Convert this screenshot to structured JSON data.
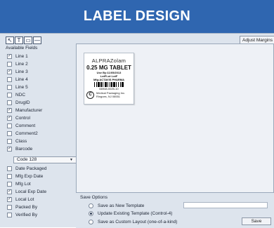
{
  "banner": {
    "title": "LABEL DESIGN"
  },
  "toolbar": {
    "tools": [
      {
        "name": "pointer-tool",
        "glyph": "↖"
      },
      {
        "name": "text-tool",
        "glyph": "T"
      },
      {
        "name": "rectangle-tool",
        "glyph": "▭"
      },
      {
        "name": "line-tool",
        "glyph": "—"
      }
    ],
    "adjust_label": "Adjust Margins"
  },
  "fields_panel": {
    "title": "Available Fields",
    "fields": [
      {
        "label": "Line 1",
        "checked": true
      },
      {
        "label": "Line 2",
        "checked": false
      },
      {
        "label": "Line 3",
        "checked": true
      },
      {
        "label": "Line 4",
        "checked": false
      },
      {
        "label": "Line 5",
        "checked": false
      },
      {
        "label": "NDC",
        "checked": false
      },
      {
        "label": "DrugID",
        "checked": false
      },
      {
        "label": "Manufacturer",
        "checked": true
      },
      {
        "label": "Control",
        "checked": true
      },
      {
        "label": "Comment",
        "checked": false
      },
      {
        "label": "Comment2",
        "checked": false
      },
      {
        "label": "Class",
        "checked": false
      },
      {
        "label": "Barcode",
        "checked": true
      },
      {
        "label": "Date Packaged",
        "checked": false
      },
      {
        "label": "Mfg Exp Date",
        "checked": false
      },
      {
        "label": "Mfg Lot",
        "checked": false
      },
      {
        "label": "Local Exp Date",
        "checked": true
      },
      {
        "label": "Local Lot",
        "checked": true
      },
      {
        "label": "Packed By",
        "checked": false
      },
      {
        "label": "Verified By",
        "checked": false
      }
    ],
    "barcode_type": "Code 128"
  },
  "label_preview": {
    "drug_name": "ALPRAZolam",
    "strength": "0.25 MG TABLET",
    "use_by": "Use By:11/05/2013",
    "lot": "LotFLot LotF",
    "mfg": "Mfg:ACTAVIS PHARMA",
    "barcode_text": "66948-0025-10",
    "logo_letter": "C",
    "packager_line1": "Medical Packaging Inc.",
    "packager_line2": "Ringoes, NJ 08551"
  },
  "save_options": {
    "title": "Save Options",
    "options": [
      {
        "label": "Save as New Template",
        "selected": false
      },
      {
        "label": "Update Existing Template (Control-4)",
        "selected": true
      },
      {
        "label": "Save as Custom Layout (one-of-a-kind)",
        "selected": false
      }
    ],
    "save_label": "Save"
  },
  "colors": {
    "banner_bg": "#2f66b0",
    "panel_bg": "#dde4ed",
    "canvas_bg": "#eef1f6"
  }
}
